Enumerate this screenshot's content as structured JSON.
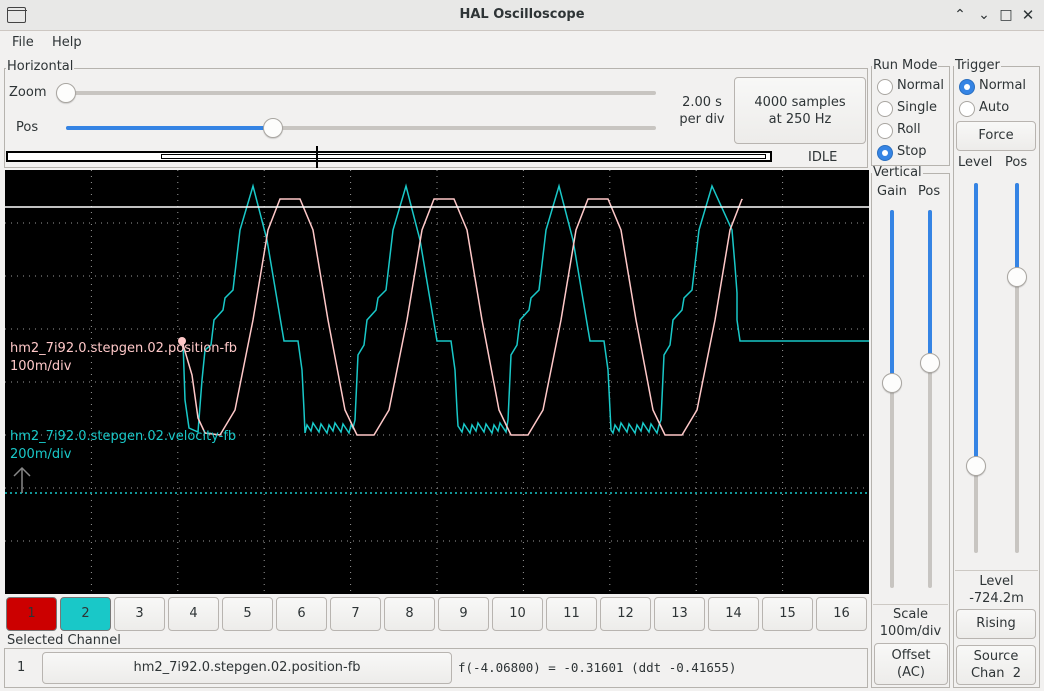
{
  "window": {
    "title": "HAL Oscilloscope"
  },
  "menu": [
    "File",
    "Help"
  ],
  "horizontal": {
    "group_label": "Horizontal",
    "zoom_label": "Zoom",
    "pos_label": "Pos",
    "scale_line1": "2.00 s",
    "scale_line2": "per div",
    "samples_line1": "4000 samples",
    "samples_line2": "at 250 Hz",
    "status": "IDLE",
    "zoom_value": 0.0,
    "pos_value": 0.35
  },
  "run_mode": {
    "group_label": "Run Mode",
    "options": [
      "Normal",
      "Single",
      "Roll",
      "Stop"
    ],
    "selected": "Stop"
  },
  "trigger": {
    "group_label": "Trigger",
    "options": [
      "Normal",
      "Auto"
    ],
    "selected": "Normal",
    "force_label": "Force",
    "level_label": "Level",
    "pos_label": "Pos",
    "level_readout_label": "Level",
    "level_readout_value": "-724.2m",
    "edge_button": "Rising",
    "source_line1": "Source",
    "source_line2": "Chan  2"
  },
  "vertical": {
    "group_label": "Vertical",
    "gain_label": "Gain",
    "pos_label": "Pos",
    "scale_label": "Scale",
    "scale_value": "100m/div",
    "offset_line1": "Offset",
    "offset_line2": "(AC)"
  },
  "traces": [
    {
      "name": "hm2_7i92.0.stepgen.02.position-fb",
      "scale": "100m/div",
      "color": "#ffc8c8"
    },
    {
      "name": "hm2_7i92.0.stepgen.02.velocity-fb",
      "scale": "200m/div",
      "color": "#19c8c8"
    }
  ],
  "channels": {
    "labels": [
      "1",
      "2",
      "3",
      "4",
      "5",
      "6",
      "7",
      "8",
      "9",
      "10",
      "11",
      "12",
      "13",
      "14",
      "15",
      "16"
    ],
    "colors": {
      "1": "#cc0000",
      "2": "#19c8c8"
    }
  },
  "selected_channel": {
    "group_label": "Selected Channel",
    "number": "1",
    "signal": "hm2_7i92.0.stepgen.02.position-fb",
    "readout": "f(-4.06800) = -0.31601 (ddt -0.41655)"
  }
}
